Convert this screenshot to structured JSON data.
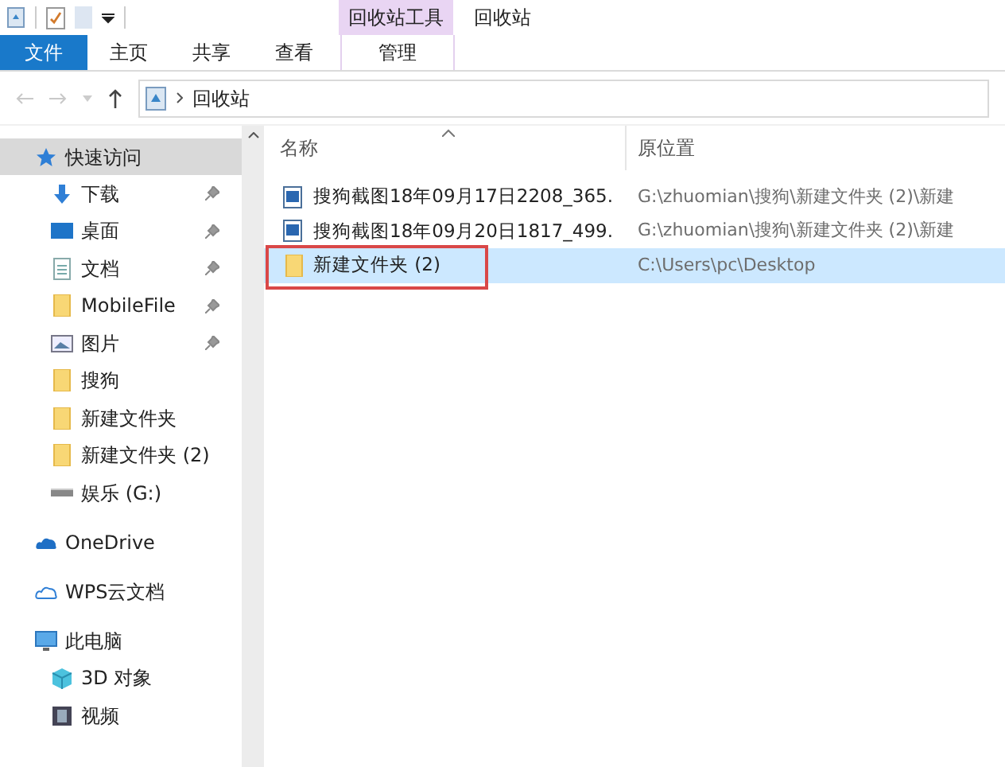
{
  "title_bar": {
    "context_tab": "回收站工具",
    "title": "回收站"
  },
  "ribbon_tabs": [
    {
      "label": "文件",
      "kind": "file",
      "selected": false
    },
    {
      "label": "主页",
      "kind": "tab",
      "selected": false
    },
    {
      "label": "共享",
      "kind": "tab",
      "selected": false
    },
    {
      "label": "查看",
      "kind": "tab",
      "selected": false
    },
    {
      "label": "管理",
      "kind": "context",
      "selected": false
    }
  ],
  "address_bar": {
    "path": "回收站"
  },
  "navigation": [
    {
      "label": "快速访问",
      "kind": "star",
      "selected": true,
      "children": [
        {
          "label": "下载",
          "kind": "download",
          "pinned": true
        },
        {
          "label": "桌面",
          "kind": "desktop",
          "pinned": true
        },
        {
          "label": "文档",
          "kind": "document",
          "pinned": true
        },
        {
          "label": "MobileFile",
          "kind": "folder",
          "pinned": true
        },
        {
          "label": "图片",
          "kind": "picture",
          "pinned": true
        },
        {
          "label": "搜狗",
          "kind": "folder",
          "pinned": false
        },
        {
          "label": "新建文件夹",
          "kind": "folder",
          "pinned": false
        },
        {
          "label": "新建文件夹 (2)",
          "kind": "folder",
          "pinned": false
        },
        {
          "label": "娱乐 (G:)",
          "kind": "drive",
          "pinned": false
        }
      ]
    },
    {
      "label": "OneDrive",
      "kind": "onedrive",
      "selected": false
    },
    {
      "label": "WPS云文档",
      "kind": "cloud",
      "selected": false
    },
    {
      "label": "此电脑",
      "kind": "pc",
      "selected": false,
      "children": [
        {
          "label": "3D 对象",
          "kind": "cube",
          "pinned": false
        },
        {
          "label": "视频",
          "kind": "video",
          "pinned": false
        }
      ]
    }
  ],
  "file_list": {
    "columns": [
      "名称",
      "原位置"
    ],
    "rows": [
      {
        "name": "搜狗截图18年09月17日2208_365.",
        "original_location": "G:\\zhuomian\\搜狗\\新建文件夹 (2)\\新建",
        "kind": "image",
        "selected": false,
        "highlighted": false
      },
      {
        "name": "搜狗截图18年09月20日1817_499.",
        "original_location": "G:\\zhuomian\\搜狗\\新建文件夹 (2)\\新建",
        "kind": "image",
        "selected": false,
        "highlighted": false
      },
      {
        "name": "新建文件夹 (2)",
        "original_location": "C:\\Users\\pc\\Desktop",
        "kind": "folder",
        "selected": true,
        "highlighted": true
      }
    ]
  }
}
